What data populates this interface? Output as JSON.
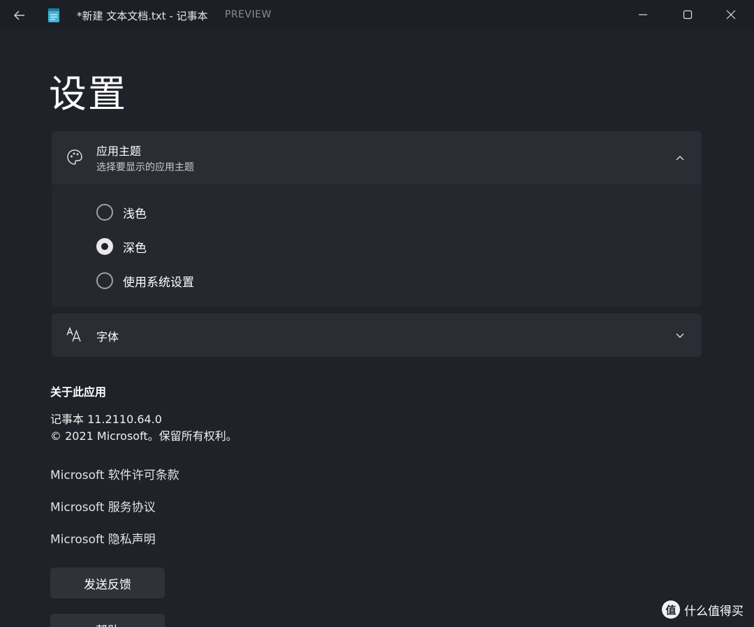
{
  "titlebar": {
    "back_icon": "back-arrow-icon",
    "app_icon": "notepad-icon",
    "title": "*新建 文本文档.txt - 记事本",
    "badge": "PREVIEW",
    "minimize_icon": "minimize-icon",
    "maximize_icon": "maximize-icon",
    "close_icon": "close-icon"
  },
  "page": {
    "title": "设置"
  },
  "theme_card": {
    "icon": "palette-icon",
    "title": "应用主题",
    "subtitle": "选择要显示的应用主题",
    "expanded": true,
    "options": [
      {
        "label": "浅色",
        "checked": false
      },
      {
        "label": "深色",
        "checked": true
      },
      {
        "label": "使用系统设置",
        "checked": false
      }
    ]
  },
  "font_card": {
    "icon": "font-icon",
    "title": "字体",
    "expanded": false
  },
  "about": {
    "heading": "关于此应用",
    "version": "记事本 11.2110.64.0",
    "copyright": "© 2021 Microsoft。保留所有权利。",
    "links": [
      "Microsoft 软件许可条款",
      "Microsoft 服务协议",
      "Microsoft 隐私声明"
    ],
    "buttons": [
      "发送反馈",
      "帮助"
    ]
  },
  "watermark": {
    "logo": "值",
    "text": "什么值得买"
  },
  "colors": {
    "background": "#1f2228",
    "card": "#2a2d34",
    "text": "#ffffff"
  }
}
